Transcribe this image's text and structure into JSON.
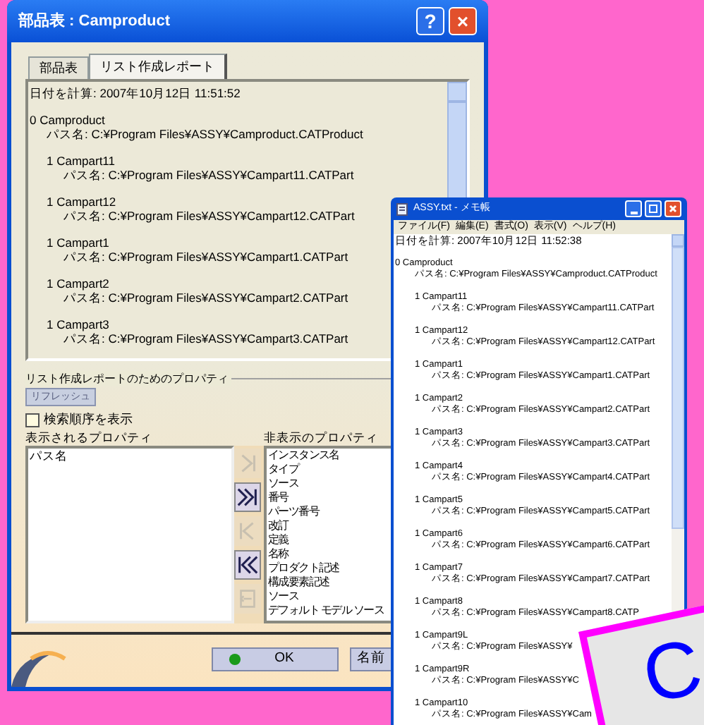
{
  "dialog": {
    "title": "部品表 : Camproduct",
    "title_buttons": [
      "?",
      "×"
    ],
    "tabs": [
      {
        "label": "部品表",
        "selected": false
      },
      {
        "label": "リスト作成レポート",
        "selected": true
      }
    ],
    "report": {
      "timestamp": "日付を計算: 2007年10月12日 11:51:52",
      "entries": [
        {
          "title": "0 Camproduct",
          "path": "パス名: C:¥Program Files¥ASSY¥Camproduct.CATProduct"
        },
        {
          "title": "1 Campart11",
          "path": "パス名: C:¥Program Files¥ASSY¥Campart11.CATPart"
        },
        {
          "title": "1 Campart12",
          "path": "パス名: C:¥Program Files¥ASSY¥Campart12.CATPart"
        },
        {
          "title": "1 Campart1",
          "path": "パス名: C:¥Program Files¥ASSY¥Campart1.CATPart"
        },
        {
          "title": "1 Campart2",
          "path": "パス名: C:¥Program Files¥ASSY¥Campart2.CATPart"
        },
        {
          "title": "1 Campart3",
          "path": "パス名: C:¥Program Files¥ASSY¥Campart3.CATPart"
        }
      ]
    },
    "properties": {
      "title": "リスト作成レポートのためのプロパティ",
      "refresh_button": {
        "label": "リフレッシュ",
        "disabled": true
      },
      "show_search_order": {
        "label": "検索順序を表示",
        "checked": false
      },
      "displayed": {
        "label": "表示されるプロパティ",
        "items": [
          "パス名"
        ]
      },
      "hidden": {
        "label": "非表示のプロパティ",
        "items": [
          "インスタンス名",
          "タイプ",
          "ソース",
          "番号",
          "パーツ番号",
          "改訂",
          "定義",
          "名称",
          "プロダクト記述",
          "構成要素記述",
          "ソース",
          "デフォルト モデル ソース"
        ]
      },
      "arrow_buttons": [
        {
          "kind": "add",
          "disabled": true
        },
        {
          "kind": "add_all",
          "disabled": false
        },
        {
          "kind": "remove",
          "disabled": true
        },
        {
          "kind": "remove_all",
          "disabled": false
        },
        {
          "kind": "insert",
          "disabled": true
        }
      ]
    },
    "buttons": [
      {
        "label": "OK"
      },
      {
        "label": "名前"
      }
    ]
  },
  "notepad": {
    "title": "ASSY.txt - メモ帳",
    "menu": [
      "ファイル(F)",
      "編集(E)",
      "書式(O)",
      "表示(V)",
      "ヘルプ(H)"
    ],
    "timestamp": "日付を計算: 2007年10月12日 11:52:38",
    "entries": [
      {
        "title": "0 Camproduct",
        "path": "パス名: C:¥Program Files¥ASSY¥Camproduct.CATProduct"
      },
      {
        "title": "1 Campart11",
        "path": "パス名: C:¥Program Files¥ASSY¥Campart11.CATPart"
      },
      {
        "title": "1 Campart12",
        "path": "パス名: C:¥Program Files¥ASSY¥Campart12.CATPart"
      },
      {
        "title": "1 Campart1",
        "path": "パス名: C:¥Program Files¥ASSY¥Campart1.CATPart"
      },
      {
        "title": "1 Campart2",
        "path": "パス名: C:¥Program Files¥ASSY¥Campart2.CATPart"
      },
      {
        "title": "1 Campart3",
        "path": "パス名: C:¥Program Files¥ASSY¥Campart3.CATPart"
      },
      {
        "title": "1 Campart4",
        "path": "パス名: C:¥Program Files¥ASSY¥Campart4.CATPart"
      },
      {
        "title": "1 Campart5",
        "path": "パス名: C:¥Program Files¥ASSY¥Campart5.CATPart"
      },
      {
        "title": "1 Campart6",
        "path": "パス名: C:¥Program Files¥ASSY¥Campart6.CATPart"
      },
      {
        "title": "1 Campart7",
        "path": "パス名: C:¥Program Files¥ASSY¥Campart7.CATPart"
      },
      {
        "title": "1 Campart8",
        "path": "パス名: C:¥Program Files¥ASSY¥Campart8.CATP"
      },
      {
        "title": "1 Campart9L",
        "path": "パス名: C:¥Program Files¥ASSY¥"
      },
      {
        "title": "1 Campart9R",
        "path": "パス名: C:¥Program Files¥ASSY¥C"
      },
      {
        "title": "1 Campart10",
        "path": "パス名: C:¥Program Files¥ASSY¥Cam"
      }
    ]
  },
  "callout": {
    "text": "C"
  }
}
